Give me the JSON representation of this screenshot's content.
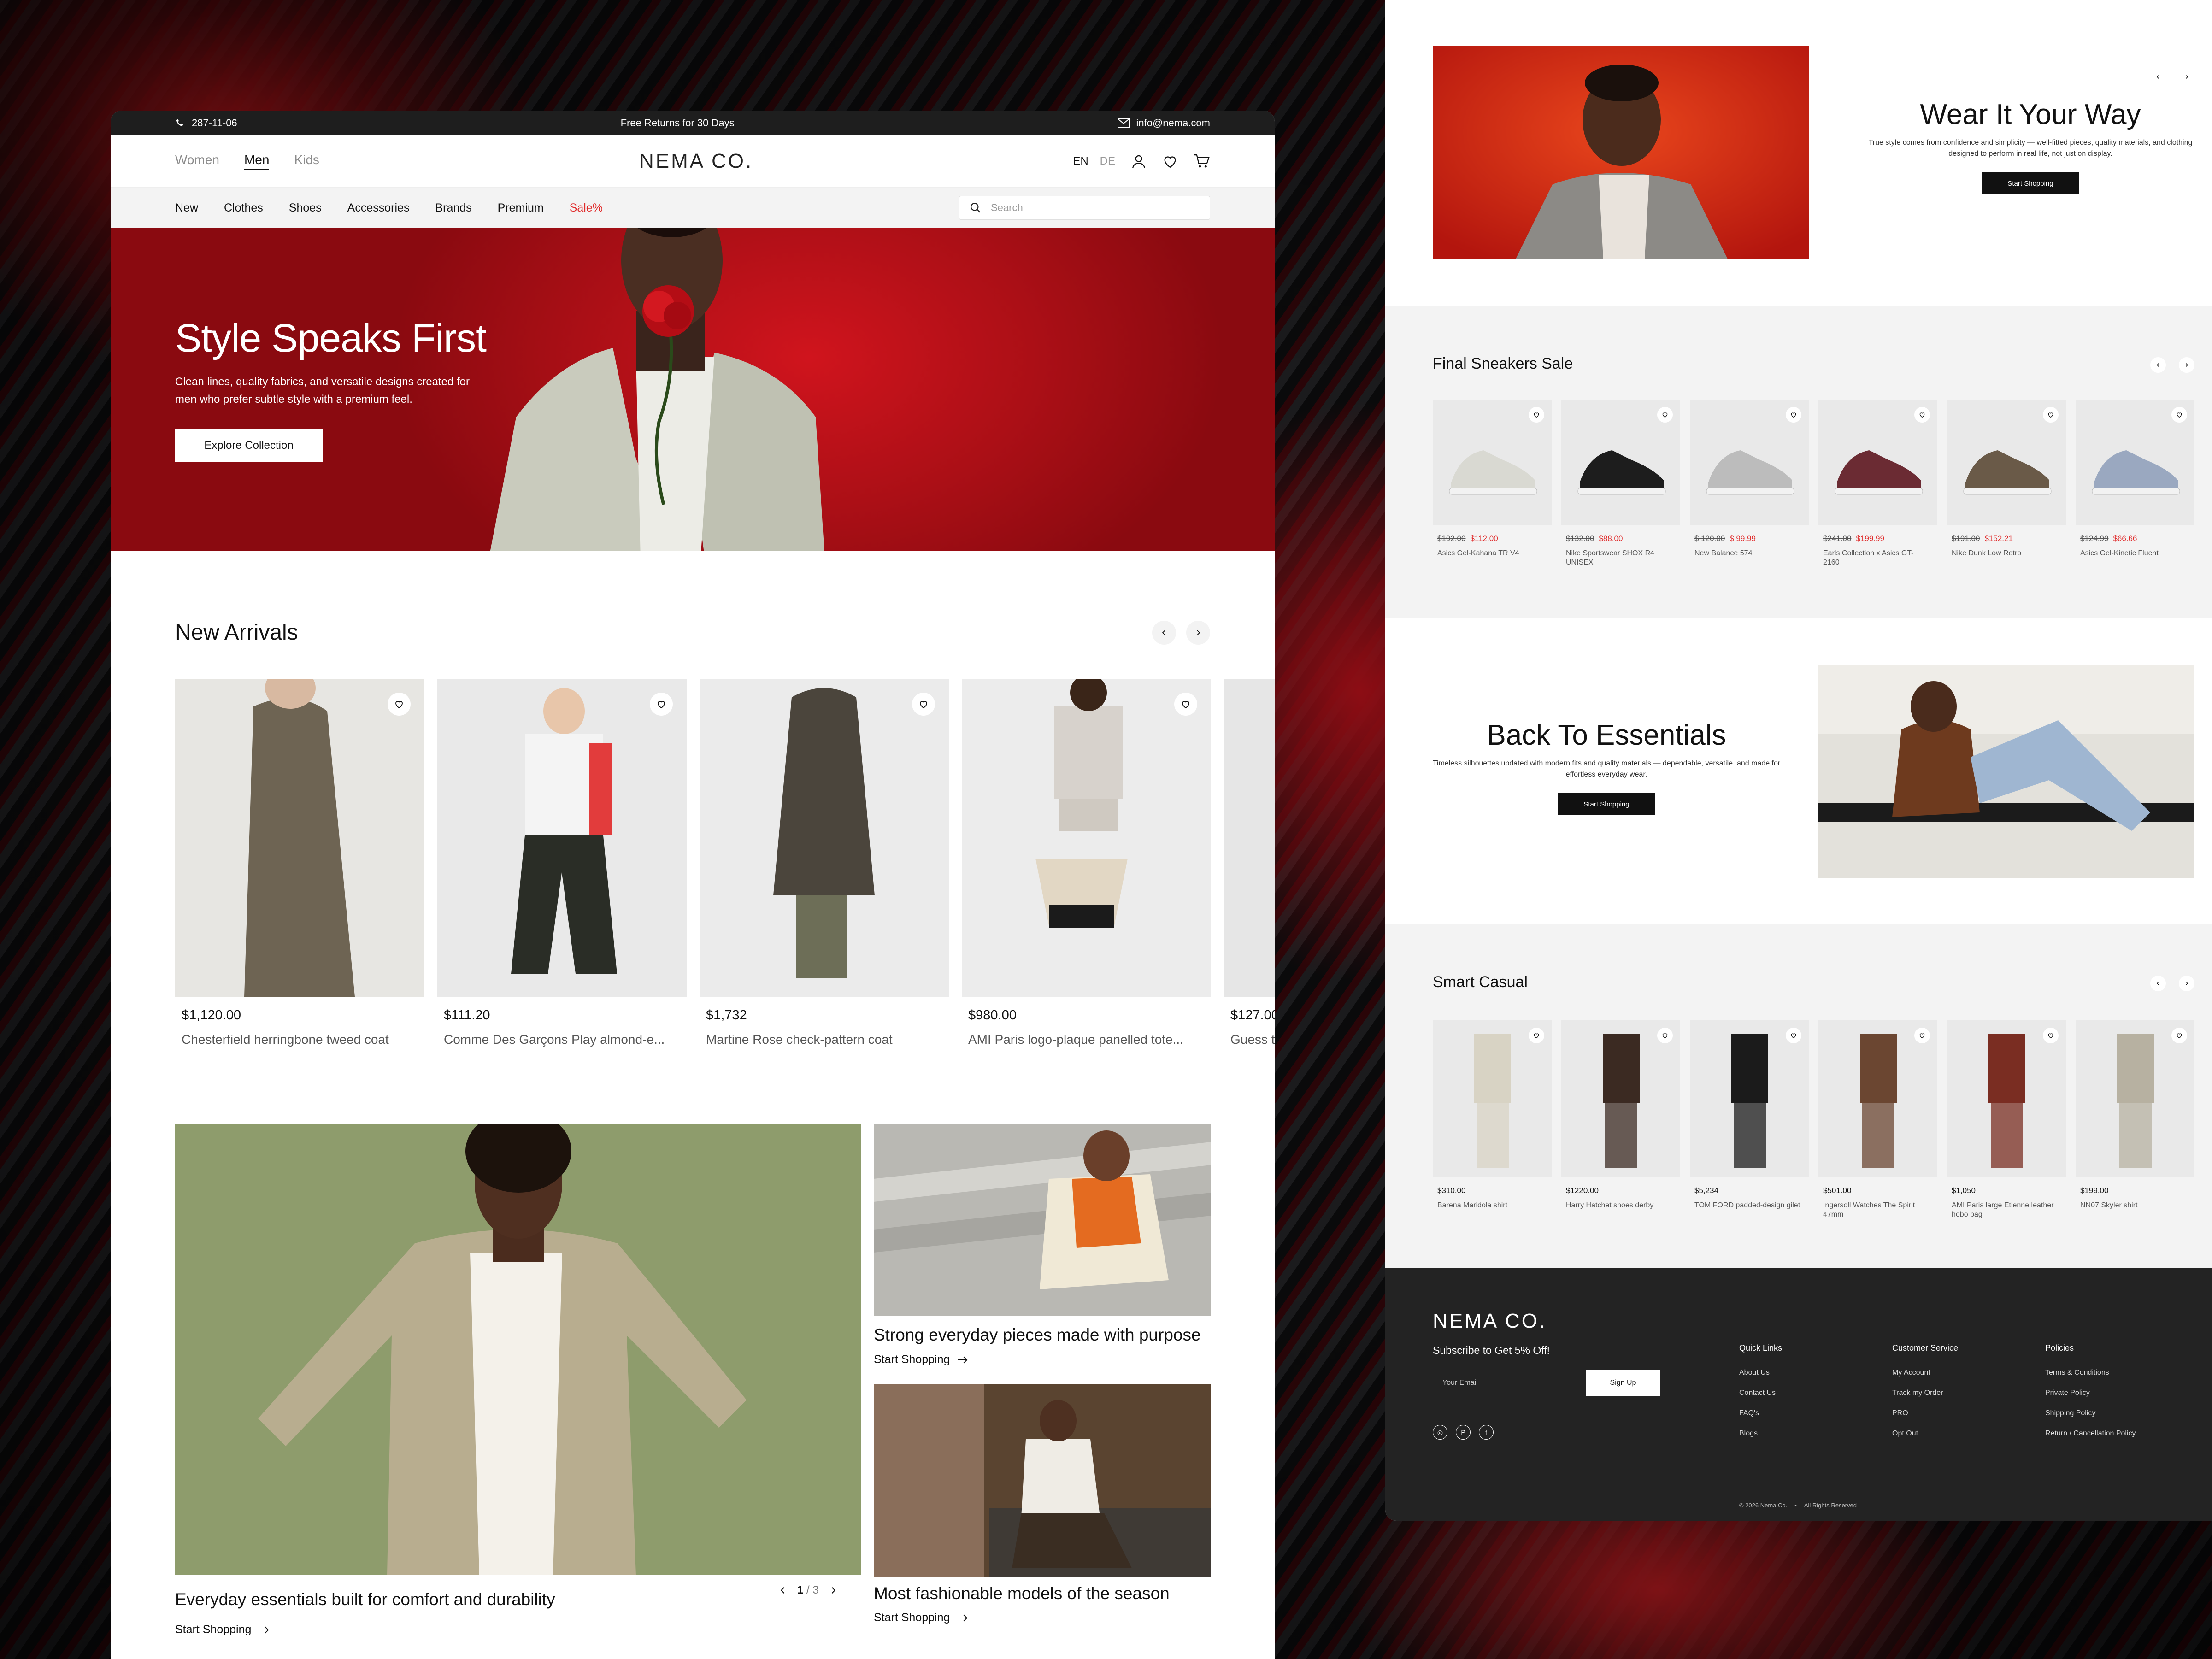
{
  "topbar": {
    "phone": "287-11-06",
    "promo": "Free Returns for 30 Days",
    "email": "info@nema.com"
  },
  "header": {
    "genders": [
      "Women",
      "Men",
      "Kids"
    ],
    "active_gender": "Men",
    "logo": "NEMA CO.",
    "lang_en": "EN",
    "lang_de": "DE"
  },
  "nav": {
    "items": [
      "New",
      "Clothes",
      "Shoes",
      "Accessories",
      "Brands",
      "Premium",
      "Sale%"
    ],
    "search_placeholder": "Search"
  },
  "hero": {
    "title": "Style Speaks First",
    "subtitle": "Clean lines, quality fabrics, and versatile designs created for men who prefer subtle style with a premium feel.",
    "button": "Explore Collection"
  },
  "new_arrivals": {
    "title": "New Arrivals",
    "products": [
      {
        "price": "$1,120.00",
        "name": "Chesterfield herringbone tweed coat"
      },
      {
        "price": "$111.20",
        "name": "Comme Des Garçons Play almond-e..."
      },
      {
        "price": "$1,732",
        "name": "Martine Rose check-pattern coat"
      },
      {
        "price": "$980.00",
        "name": "AMI Paris logo-plaque panelled tote..."
      },
      {
        "price": "$127.00",
        "name": "Guess t"
      }
    ]
  },
  "features": {
    "big_caption": "Everyday essentials built for comfort and durability",
    "big_link": "Start Shopping",
    "pager_current": "1",
    "pager_total": "/ 3",
    "small1_caption": "Strong everyday pieces made with purpose",
    "small1_link": "Start Shopping",
    "small2_caption": "Most fashionable models of the season",
    "small2_link": "Start Shopping"
  },
  "wear": {
    "title": "Wear It Your Way",
    "subtitle": "True style comes from confidence and simplicity — well-fitted pieces, quality materials, and clothing designed to perform in real life, not just on display.",
    "button": "Start Shopping"
  },
  "sneakers": {
    "title": "Final Sneakers Sale",
    "products": [
      {
        "old": "$192.00",
        "new": "$112.00",
        "name": "Asics Gel-Kahana TR V4",
        "tone": "#d9d9d2"
      },
      {
        "old": "$132.00",
        "new": "$88.00",
        "name": "Nike Sportswear SHOX R4 UNISEX",
        "tone": "#1d1d1d"
      },
      {
        "old": "$ 120.00",
        "new": "$ 99.99",
        "name": "New Balance 574",
        "tone": "#bcbcbc"
      },
      {
        "old": "$241.00",
        "new": "$199.99",
        "name": "Earls Collection x Asics GT-2160",
        "tone": "#6b2b33"
      },
      {
        "old": "$191.00",
        "new": "$152.21",
        "name": "Nike Dunk Low Retro",
        "tone": "#6a5a48"
      },
      {
        "old": "$124.99",
        "new": "$66.66",
        "name": "Asics Gel-Kinetic Fluent",
        "tone": "#9aa8c0"
      }
    ]
  },
  "essentials": {
    "title": "Back To Essentials",
    "subtitle": "Timeless silhouettes updated with modern fits and quality materials — dependable, versatile, and made for effortless everyday wear.",
    "button": "Start Shopping"
  },
  "smart_casual": {
    "title": "Smart Casual",
    "products": [
      {
        "price": "$310.00",
        "name": "Barena Maridola shirt",
        "tone": "#d8d3c4"
      },
      {
        "price": "$1220.00",
        "name": "Harry Hatchet shoes derby",
        "tone": "#3b2a22"
      },
      {
        "price": "$5,234",
        "name": "TOM FORD padded-design gilet",
        "tone": "#1b1b1b"
      },
      {
        "price": "$501.00",
        "name": "Ingersoll Watches The Spirit 47mm",
        "tone": "#6b4631"
      },
      {
        "price": "$1,050",
        "name": "AMI Paris large Etienne leather hobo bag",
        "tone": "#7a2d22"
      },
      {
        "price": "$199.00",
        "name": "NN07 Skyler shirt",
        "tone": "#b7b1a1"
      }
    ]
  },
  "footer": {
    "logo": "NEMA CO.",
    "subscribe": "Subscribe to Get 5% Off!",
    "email_placeholder": "Your Email",
    "signup": "Sign Up",
    "columns": [
      {
        "title": "Quick Links",
        "items": [
          "About Us",
          "Contact Us",
          "FAQ's",
          "Blogs"
        ]
      },
      {
        "title": "Customer Service",
        "items": [
          "My Account",
          "Track my Order",
          "PRO",
          "Opt Out"
        ]
      },
      {
        "title": "Policies",
        "items": [
          "Terms & Conditions",
          "Private Policy",
          "Shipping Policy",
          "Return / Cancellation Policy"
        ]
      }
    ],
    "copyright": "© 2026 Nema Co.",
    "rights": "All Rights Reserved"
  }
}
